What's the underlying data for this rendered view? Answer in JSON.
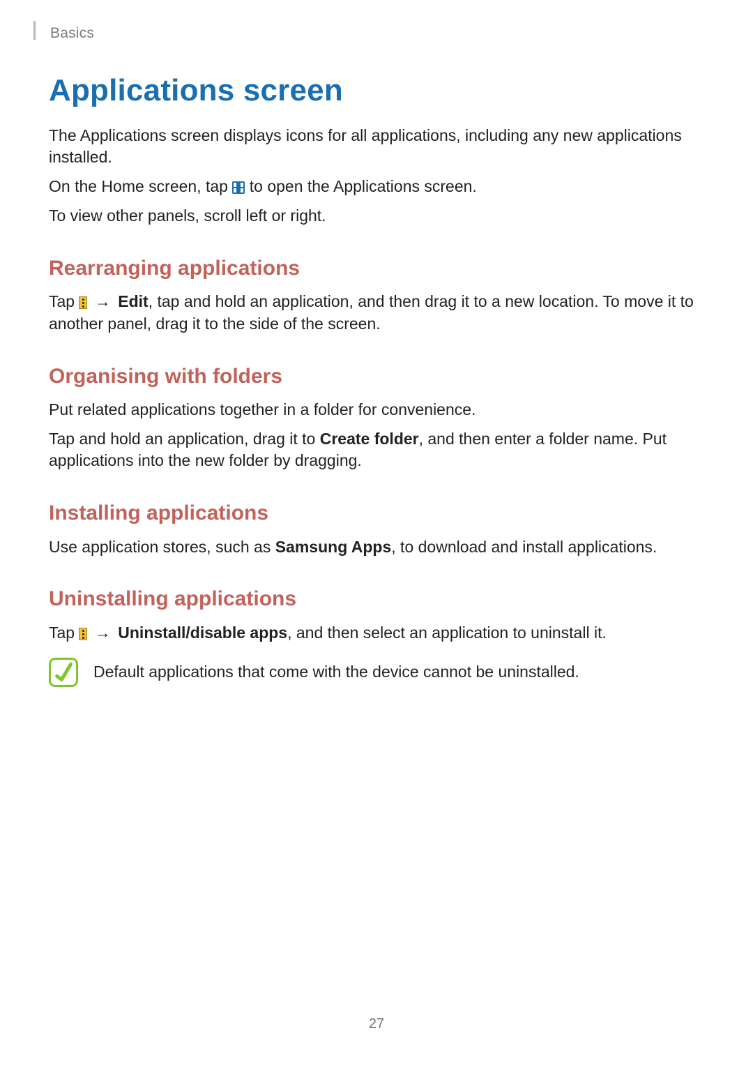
{
  "header": {
    "section": "Basics"
  },
  "title": "Applications screen",
  "intro": [
    "The Applications screen displays icons for all applications, including any new applications installed."
  ],
  "home_line": {
    "pre": "On the Home screen, tap ",
    "post": " to open the Applications screen."
  },
  "scroll_line": "To view other panels, scroll left or right.",
  "sections": {
    "rearranging": {
      "heading": "Rearranging applications",
      "line": {
        "pre": "Tap ",
        "arrow": " → ",
        "bold": "Edit",
        "post": ", tap and hold an application, and then drag it to a new location. To move it to another panel, drag it to the side of the screen."
      }
    },
    "organising": {
      "heading": "Organising with folders",
      "p1": "Put related applications together in a folder for convenience.",
      "p2": {
        "pre": "Tap and hold an application, drag it to ",
        "bold": "Create folder",
        "post": ", and then enter a folder name. Put applications into the new folder by dragging."
      }
    },
    "installing": {
      "heading": "Installing applications",
      "p": {
        "pre": "Use application stores, such as ",
        "bold": "Samsung Apps",
        "post": ", to download and install applications."
      }
    },
    "uninstalling": {
      "heading": "Uninstalling applications",
      "line": {
        "pre": "Tap ",
        "arrow": " → ",
        "bold": "Uninstall/disable apps",
        "post": ", and then select an application to uninstall it."
      },
      "note": "Default applications that come with the device cannot be uninstalled."
    }
  },
  "page_number": "27"
}
